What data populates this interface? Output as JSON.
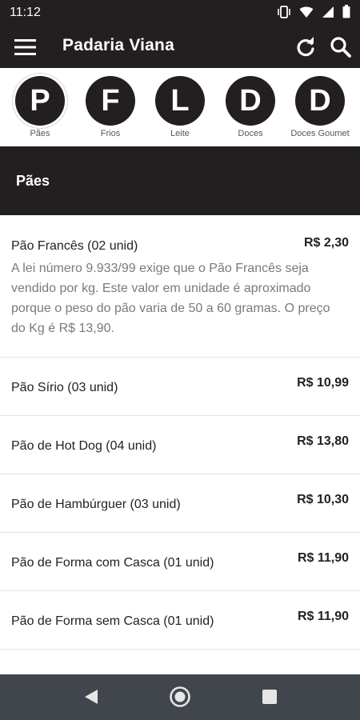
{
  "status": {
    "time": "11:12",
    "icons": [
      "vibrate-icon",
      "wifi-icon",
      "signal-icon",
      "battery-icon"
    ]
  },
  "appbar": {
    "title": "Padaria Viana",
    "icons": [
      "menu-icon",
      "refresh-icon",
      "search-icon"
    ]
  },
  "categories": [
    {
      "letter": "P",
      "label": "Pães"
    },
    {
      "letter": "F",
      "label": "Frios"
    },
    {
      "letter": "L",
      "label": "Leite"
    },
    {
      "letter": "D",
      "label": "Doces"
    },
    {
      "letter": "D",
      "label": "Doces Goumet"
    }
  ],
  "section": {
    "title": "Pães"
  },
  "items": [
    {
      "name": "Pão Francês (02 unid)",
      "price": "R$ 2,30",
      "description": "A lei número 9.933/99 exige que o Pão Francês seja vendido por kg. Este valor em unidade é aproximado porque o peso do pão varia de 50 a 60 gramas. O preço do Kg é R$ 13,90."
    },
    {
      "name": "Pão Sírio (03 unid)",
      "price": "R$ 10,99"
    },
    {
      "name": "Pão de Hot Dog (04 unid)",
      "price": "R$ 13,80"
    },
    {
      "name": "Pão de Hambúrguer (03 unid)",
      "price": "R$ 10,30"
    },
    {
      "name": "Pão de Forma com Casca (01 unid)",
      "price": "R$ 11,90"
    },
    {
      "name": "Pão de Forma sem Casca (01 unid)",
      "price": "R$ 11,90"
    }
  ],
  "colors": {
    "bar": "#231f20",
    "navbar": "#41464c",
    "background": "#ffffff"
  }
}
